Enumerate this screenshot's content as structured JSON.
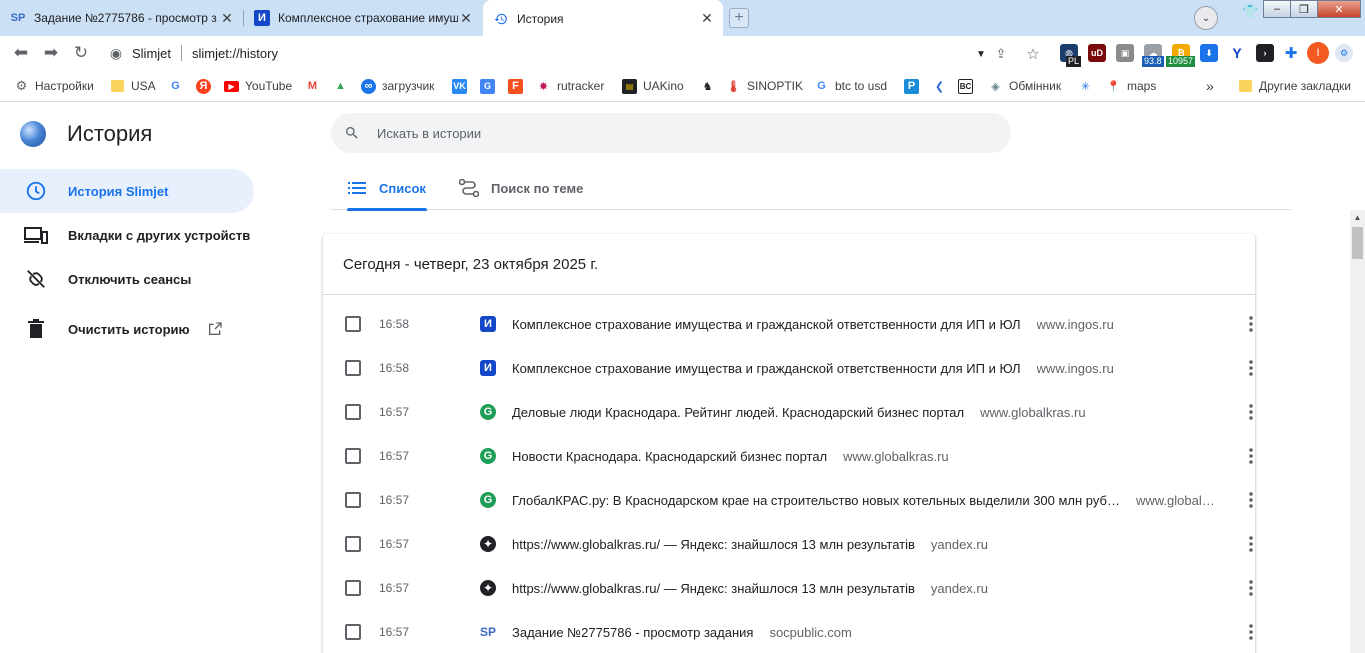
{
  "tabs": [
    {
      "title": "Задание №2775786 - просмотр з",
      "icon": "SP",
      "active": false
    },
    {
      "title": "Комплексное страхование имущ",
      "icon": "И",
      "active": false
    },
    {
      "title": "История",
      "icon": "history-icon",
      "active": true
    }
  ],
  "omnibox": {
    "site_name": "Slimjet",
    "url": "slimjet://history"
  },
  "extension_badges": {
    "first": "93.8",
    "second": "10957",
    "pl": "PL"
  },
  "profile_initial": "I",
  "bookmarks": [
    {
      "label": "Настройки"
    },
    {
      "label": "USA"
    },
    {
      "label": ""
    },
    {
      "label": ""
    },
    {
      "label": "YouTube"
    },
    {
      "label": ""
    },
    {
      "label": ""
    },
    {
      "label": "загрузчик"
    },
    {
      "label": ""
    },
    {
      "label": ""
    },
    {
      "label": ""
    },
    {
      "label": "rutracker"
    },
    {
      "label": "UAKino"
    },
    {
      "label": ""
    },
    {
      "label": "SINOPTIK"
    },
    {
      "label": "btc to usd"
    },
    {
      "label": ""
    },
    {
      "label": ""
    },
    {
      "label": "BC"
    },
    {
      "label": "Обмінник"
    },
    {
      "label": ""
    },
    {
      "label": "maps"
    }
  ],
  "bookmarks_overflow": "»",
  "other_bookmarks": "Другие закладки",
  "page": {
    "title": "История",
    "search_placeholder": "Искать в истории",
    "sidebar": [
      {
        "label": "История Slimjet",
        "active": true
      },
      {
        "label": "Вкладки с других устройств",
        "active": false
      },
      {
        "label": "Отключить сеансы",
        "active": false
      },
      {
        "label": "Очистить историю",
        "active": false
      }
    ],
    "view_tabs": [
      {
        "label": "Список",
        "active": true
      },
      {
        "label": "Поиск по теме",
        "active": false
      }
    ],
    "date_header": "Сегодня - четверг, 23 октября 2025 г.",
    "entries": [
      {
        "time": "16:58",
        "title": "Комплексное страхование имущества и гражданской ответственности для ИП и ЮЛ",
        "domain": "www.ingos.ru",
        "favicon": "И"
      },
      {
        "time": "16:58",
        "title": "Комплексное страхование имущества и гражданской ответственности для ИП и ЮЛ",
        "domain": "www.ingos.ru",
        "favicon": "И"
      },
      {
        "time": "16:57",
        "title": "Деловые люди Краснодара. Рейтинг людей. Краснодарский бизнес портал",
        "domain": "www.globalkras.ru",
        "favicon": "G"
      },
      {
        "time": "16:57",
        "title": "Новости Краснодара. Краснодарский бизнес портал",
        "domain": "www.globalkras.ru",
        "favicon": "G"
      },
      {
        "time": "16:57",
        "title": "ГлобалКРАС.ру: В Краснодарском крае на строительство новых котельных выделили 300 млн руб…",
        "domain": "www.global…",
        "favicon": "G"
      },
      {
        "time": "16:57",
        "title": "https://www.globalkras.ru/ — Яндекс: знайшлося 13 млн результатів",
        "domain": "yandex.ru",
        "favicon": "Y"
      },
      {
        "time": "16:57",
        "title": "https://www.globalkras.ru/ — Яндекс: знайшлося 13 млн результатів",
        "domain": "yandex.ru",
        "favicon": "Y"
      },
      {
        "time": "16:57",
        "title": "Задание №2775786 - просмотр задания",
        "domain": "socpublic.com",
        "favicon": "SP"
      }
    ]
  },
  "colors": {
    "accent": "#1a73e8",
    "tabstrip": "#cbdff5",
    "active_item_bg": "#e8f0fe"
  }
}
